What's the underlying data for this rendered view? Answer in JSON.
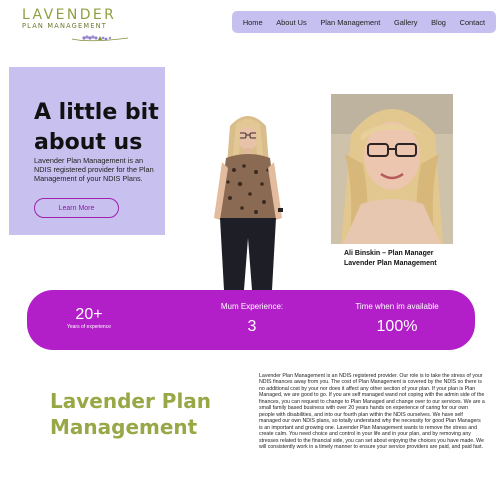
{
  "logo": {
    "line1": "LAVENDER",
    "line2": "PLAN MANAGEMENT"
  },
  "nav": {
    "items": [
      "Home",
      "About Us",
      "Plan Management",
      "Gallery",
      "Blog",
      "Contact"
    ]
  },
  "hero": {
    "title": "A little bit about us",
    "text": "Lavender Plan Management is an NDIS registered provider for the Plan Management of your NDIS Plans.",
    "button_label": "Learn More"
  },
  "caption": {
    "line1": "Ali Binskin – Plan Manager",
    "line2": "Lavender Plan Management"
  },
  "stats": [
    {
      "value": "20+",
      "label": "Years of experience"
    },
    {
      "label": "Mum Experience:",
      "value": "3"
    },
    {
      "label": "Time when im available",
      "value": "100%"
    }
  ],
  "section": {
    "title": "Lavender Plan Management",
    "body": "Lavender Plan Management is an NDIS registered provider. Our role is to take the stress of your NDIS finances away from you. The cost of Plan Management is covered by the NDIS so there is no additional cost by your nor does it affect any other section of your plan. If your plan is Plan Managed, we are good to go. If you are self managed wand not coping with the admin side of the finances, you can request to change to Plan Managed and change over to our services. We are a small family based business with over 20 years hands on experience of caring for our own people with disabilities, and into our fourth plan within the NDIS ourselves. We have self managed our own NDIS plans, so totally understand why the necessity for good Plan Managers is an important and growing one. Lavender Plan Management wants to remove the stress and create calm. You need choice and control in your life and in your plan, and by removing any stresses related to the financial side, you can set about enjoying the choices you have made. We will consistently work in a timely manner to ensure your service providers are paid, and paid fast."
  },
  "colors": {
    "nav_bg": "#c5c0ef",
    "card_bg": "#c8c1ef",
    "stats_bg": "#b21fc9",
    "brand_green": "#98a847",
    "button_accent": "#a020b0"
  }
}
